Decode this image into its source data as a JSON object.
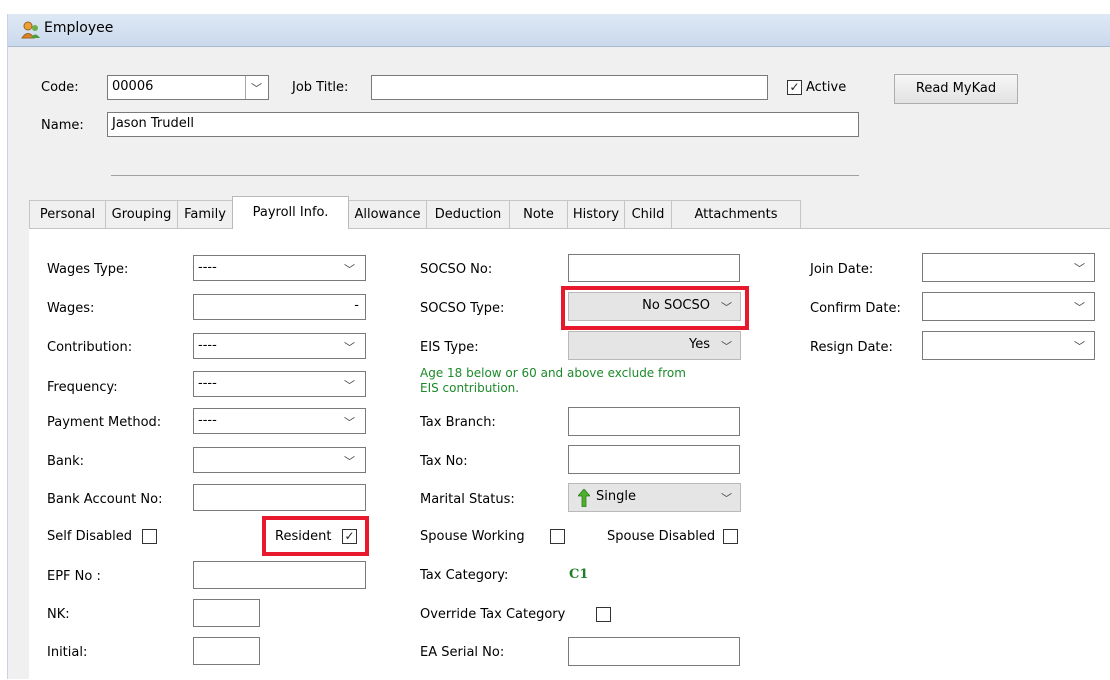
{
  "window": {
    "title": "Employee",
    "icon": "employee-icon"
  },
  "header": {
    "code_label": "Code:",
    "code_value": "00006",
    "job_title_label": "Job Title:",
    "job_title_value": "",
    "active_label": "Active",
    "active_checked": true,
    "read_mykad_label": "Read MyKad",
    "name_label": "Name:",
    "name_value": "Jason Trudell"
  },
  "tabs": [
    {
      "label": "Personal"
    },
    {
      "label": "Grouping"
    },
    {
      "label": "Family"
    },
    {
      "label": "Payroll Info."
    },
    {
      "label": "Allowance"
    },
    {
      "label": "Deduction"
    },
    {
      "label": "Note"
    },
    {
      "label": "History"
    },
    {
      "label": "Child"
    },
    {
      "label": "Attachments"
    }
  ],
  "active_tab": "Payroll Info.",
  "left": {
    "wages_type_label": "Wages Type:",
    "wages_type_value": "----",
    "wages_label": "Wages:",
    "wages_value": "-",
    "contribution_label": "Contribution:",
    "contribution_value": "----",
    "frequency_label": "Frequency:",
    "frequency_value": "----",
    "payment_method_label": "Payment Method:",
    "payment_method_value": "----",
    "bank_label": "Bank:",
    "bank_value": "",
    "bank_account_label": "Bank Account No:",
    "bank_account_value": "",
    "self_disabled_label": "Self Disabled",
    "self_disabled_checked": false,
    "resident_label": "Resident",
    "resident_checked": true,
    "epf_label": "EPF No :",
    "epf_value": "",
    "nk_label": "NK:",
    "nk_value": "",
    "initial_label": "Initial:",
    "initial_value": ""
  },
  "middle": {
    "socso_no_label": "SOCSO No:",
    "socso_no_value": "",
    "socso_type_label": "SOCSO Type:",
    "socso_type_value": "No SOCSO",
    "eis_type_label": "EIS Type:",
    "eis_type_value": "Yes",
    "eis_note_line1": "Age 18 below or 60 and above exclude from",
    "eis_note_line2": "EIS contribution.",
    "tax_branch_label": "Tax Branch:",
    "tax_branch_value": "",
    "tax_no_label": "Tax No:",
    "tax_no_value": "",
    "marital_status_label": "Marital Status:",
    "marital_status_value": "Single",
    "spouse_working_label": "Spouse Working",
    "spouse_working_checked": false,
    "spouse_disabled_label": "Spouse Disabled",
    "spouse_disabled_checked": false,
    "tax_category_label": "Tax Category:",
    "tax_category_value": "C1",
    "override_tax_label": "Override Tax Category",
    "override_tax_checked": false,
    "ea_serial_label": "EA Serial No:",
    "ea_serial_value": ""
  },
  "right": {
    "join_date_label": "Join Date:",
    "join_date_value": "",
    "confirm_date_label": "Confirm Date:",
    "confirm_date_value": "",
    "resign_date_label": "Resign Date:",
    "resign_date_value": ""
  },
  "colors": {
    "highlight": "#e8192c",
    "note_green": "#1d8a2a",
    "title_gradient": "#c9d9ec"
  }
}
